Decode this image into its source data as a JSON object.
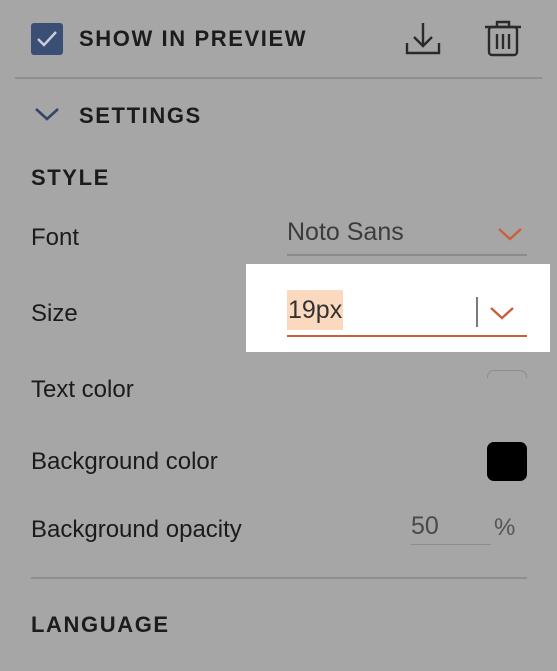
{
  "header": {
    "show_in_preview_label": "SHOW IN PREVIEW",
    "show_in_preview_checked": true,
    "download_icon": "download-icon",
    "trash_icon": "trash-icon"
  },
  "settings": {
    "label": "SETTINGS",
    "expanded": true
  },
  "style": {
    "section_label": "STYLE",
    "font": {
      "label": "Font",
      "value": "Noto Sans"
    },
    "size": {
      "label": "Size",
      "value": "19px"
    },
    "text_color": {
      "label": "Text color",
      "value": ""
    },
    "background_color": {
      "label": "Background color",
      "value": "#000000"
    },
    "background_opacity": {
      "label": "Background opacity",
      "value": "50",
      "unit": "%"
    }
  },
  "language": {
    "section_label": "LANGUAGE"
  },
  "colors": {
    "accent": "#c8603b",
    "checkbox": "#3b4e73",
    "background": "#a6a6a6",
    "highlight": "#fbd9bf"
  }
}
